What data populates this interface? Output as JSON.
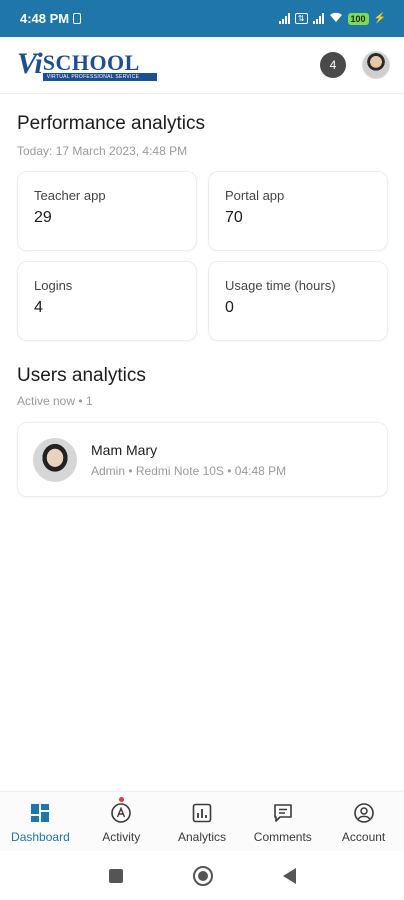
{
  "status_bar": {
    "time": "4:48 PM",
    "battery": "100"
  },
  "header": {
    "logo_vi": "Vi",
    "logo_school": "SCHOOL",
    "logo_tagline": "VIRTUAL PROFESSIONAL SERVICE",
    "notification_count": "4"
  },
  "performance": {
    "title": "Performance analytics",
    "subtitle": "Today: 17 March 2023, 4:48 PM",
    "cards": [
      {
        "label": "Teacher app",
        "value": "29"
      },
      {
        "label": "Portal app",
        "value": "70"
      },
      {
        "label": "Logins",
        "value": "4"
      },
      {
        "label": "Usage time (hours)",
        "value": "0"
      }
    ]
  },
  "users": {
    "title": "Users analytics",
    "subtitle": "Active now • 1",
    "list": [
      {
        "name": "Mam Mary",
        "meta": "Admin • Redmi Note 10S • 04:48 PM"
      }
    ]
  },
  "bottom_nav": {
    "items": [
      {
        "label": "Dashboard",
        "icon": "dashboard-icon"
      },
      {
        "label": "Activity",
        "icon": "activity-icon"
      },
      {
        "label": "Analytics",
        "icon": "analytics-icon"
      },
      {
        "label": "Comments",
        "icon": "comments-icon"
      },
      {
        "label": "Account",
        "icon": "account-icon"
      }
    ],
    "active_index": 0
  },
  "colors": {
    "accent": "#1f76a8",
    "status_bar": "#1f76a8",
    "notification_dot": "#e53935"
  }
}
